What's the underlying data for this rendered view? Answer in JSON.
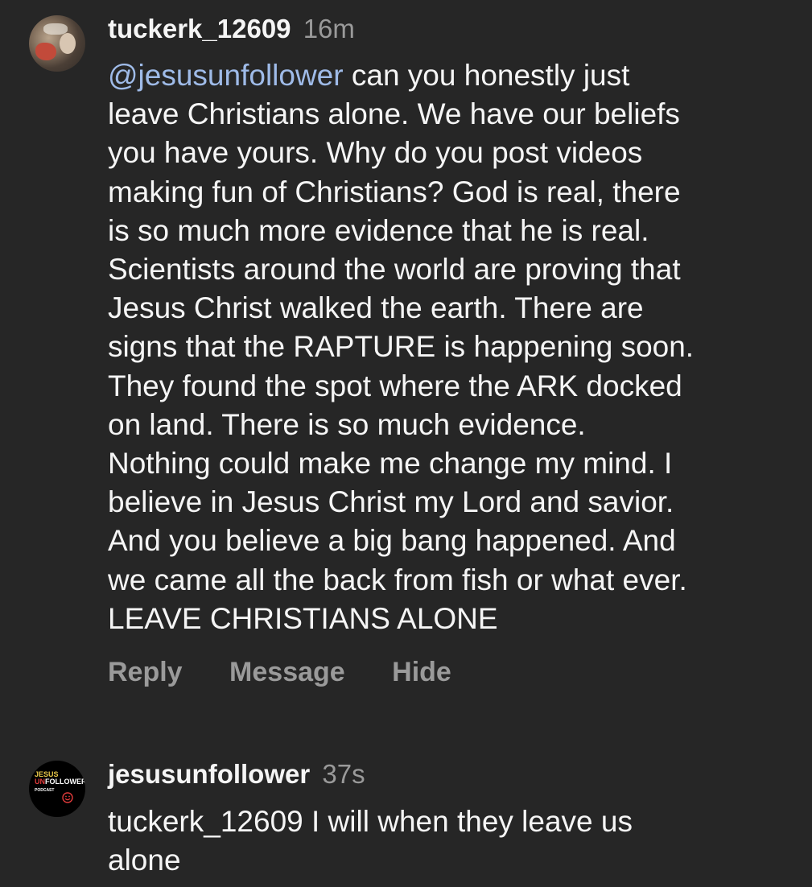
{
  "comments": [
    {
      "avatar_icon": "user-photo-avatar",
      "username": "tuckerk_12609",
      "time": "16m",
      "mention": "@jesusunfollower",
      "lines": [
        " can you honestly just",
        "leave Christians alone. We have our beliefs",
        "you have yours. Why do you post videos",
        "making fun of Christians? God is real, there",
        "is so much more evidence that he is real.",
        "Scientists around the world are proving that",
        "Jesus Christ walked the earth. There are",
        "signs that the RAPTURE is happening soon.",
        "They found the spot where the ARK docked",
        "on land. There is so much evidence.",
        "Nothing could make me change my mind. I",
        "believe in Jesus Christ my Lord and savior.",
        "And you believe a big bang happened. And",
        "we came all the back from fish or what ever.",
        "LEAVE CHRISTIANS ALONE"
      ],
      "actions": {
        "reply": "Reply",
        "message": "Message",
        "hide": "Hide"
      }
    },
    {
      "avatar_icon": "jesus-unfollower-podcast-logo",
      "logo": {
        "line1": "JESUS",
        "line2_prefix": "UN",
        "line2_suffix": "FOLLOWER",
        "line3": "PODCAST"
      },
      "username": "jesusunfollower",
      "time": "37s",
      "lines": [
        "tuckerk_12609 I will when they leave us",
        "alone"
      ]
    }
  ],
  "colors": {
    "background": "#262626",
    "text": "#f5f5f5",
    "muted": "#9a9a9a",
    "mention": "#9fbbe8"
  }
}
